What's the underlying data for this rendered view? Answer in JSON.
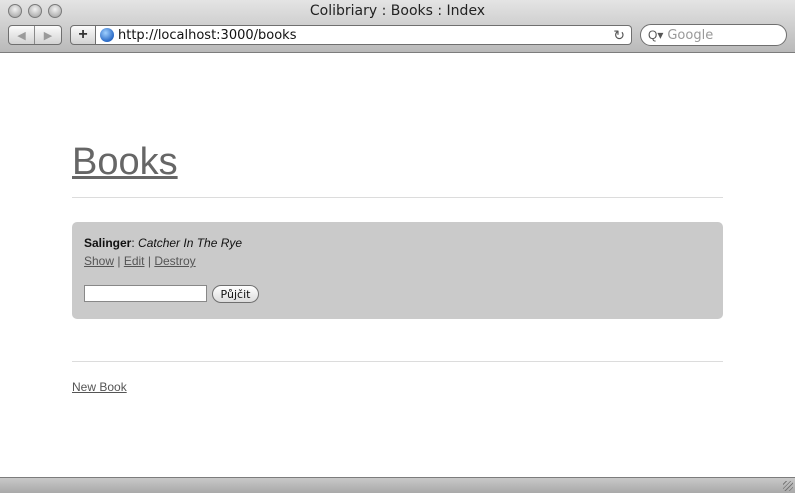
{
  "window": {
    "title": "Colibriary : Books : Index",
    "nav_back": "◀",
    "nav_forward": "▶",
    "add_tab": "+",
    "url": "http://localhost:3000/books",
    "reload": "↻",
    "search_placeholder": "Google",
    "search_icon": "Q▾"
  },
  "page": {
    "title": "Books",
    "books": [
      {
        "author": "Salinger",
        "separator": ": ",
        "name": "Catcher In The Rye",
        "actions": {
          "show": "Show",
          "edit": "Edit",
          "destroy": "Destroy",
          "divider": " | "
        },
        "borrow_value": "",
        "borrow_button": "Půjčit"
      }
    ],
    "new_book_link": "New Book"
  }
}
